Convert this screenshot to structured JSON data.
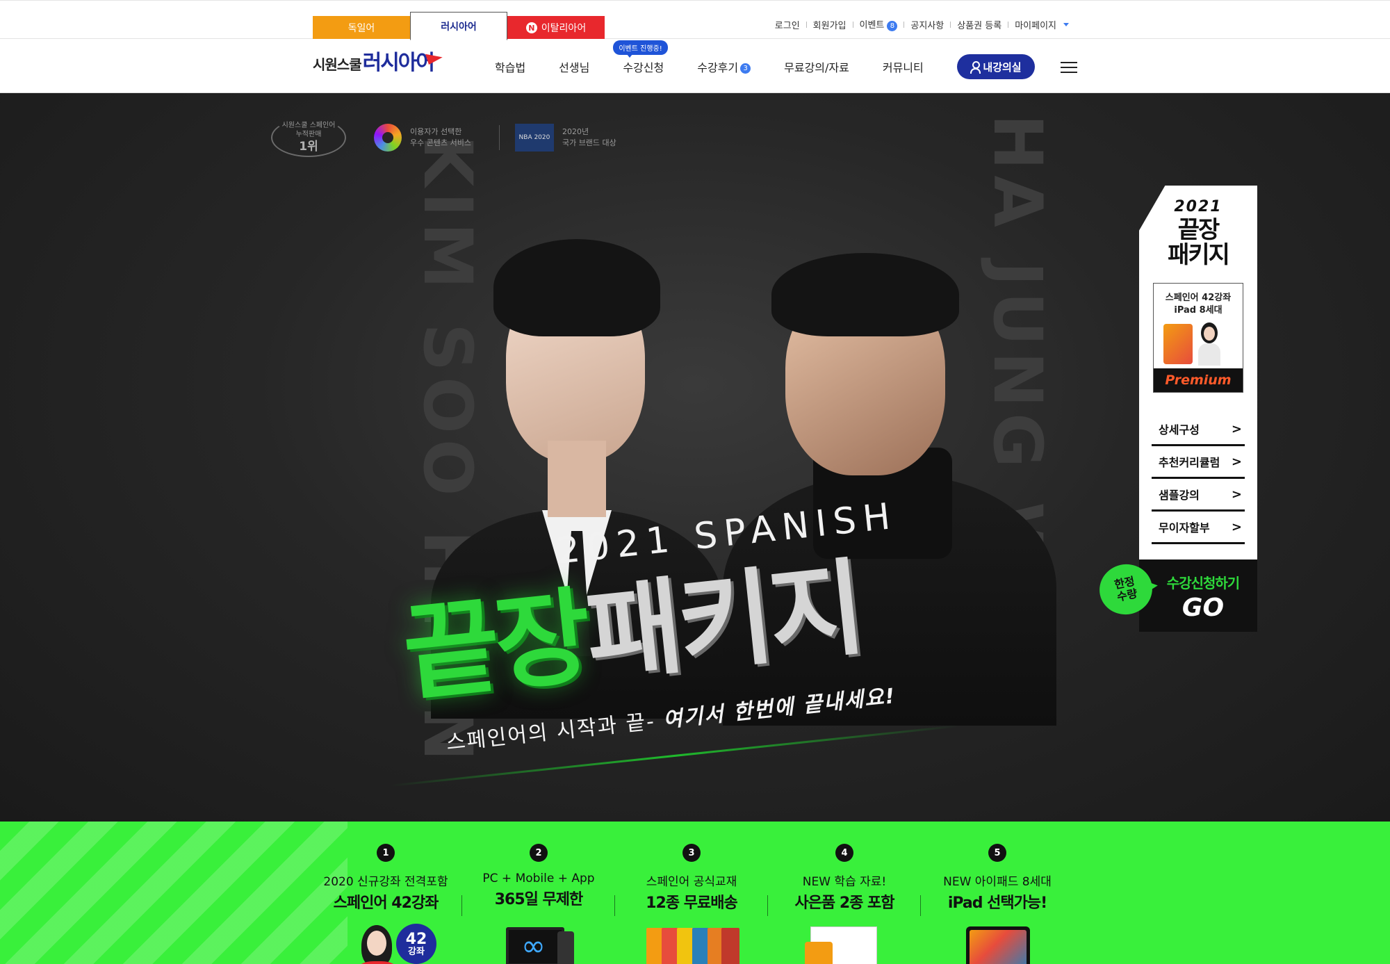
{
  "lang_tabs": [
    {
      "label": "독일어"
    },
    {
      "label": "러시아어"
    },
    {
      "label": "이탈리아어",
      "badge": "N"
    }
  ],
  "util_links": {
    "login": "로그인",
    "signup": "회원가입",
    "event": "이벤트",
    "event_count": "8",
    "notice": "공지사항",
    "voucher": "상품권 등록",
    "mypage": "마이페이지"
  },
  "logo": {
    "prefix": "시원스쿨",
    "name": "러시아어"
  },
  "nav": {
    "items": [
      "학습법",
      "선생님",
      "수강신청",
      "수강후기",
      "무료강의/자료",
      "커뮤니티"
    ],
    "event_bubble": "이벤트 진행중!",
    "review_count": "3",
    "my_classroom": "내강의실"
  },
  "hero": {
    "bg_name_left": "KIM SOO HYUN",
    "bg_name_right": "HA JUNG WOO",
    "awards": {
      "a1_line1": "시원스쿨 스페인어",
      "a1_line2": "누적판매",
      "a1_rank": "1위",
      "a2_line1": "이용자가 선택한",
      "a2_line2": "우수 콘텐츠 서비스",
      "a3_logo": "NBA 2020",
      "a3_line1": "2020년",
      "a3_line2": "국가 브랜드 대상"
    },
    "subtitle": "2021 SPANISH",
    "title_green": "끝장",
    "title_white": "패키지",
    "slogan_light": "스페인어의 시작과 끝-",
    "slogan_bold": "여기서 한번에 끝내세요!"
  },
  "side_banner": {
    "year": "2021",
    "title_l1": "끝장",
    "title_l2": "패키지",
    "card_l1": "스페인어 42강좌",
    "card_l2": "iPad 8세대",
    "card_foot": "Premium",
    "links": [
      "상세구성",
      "추천커리큘럼",
      "샘플강의",
      "무이자할부"
    ],
    "limit_l1": "한정",
    "limit_l2": "수량",
    "cta": "수강신청하기",
    "go": "GO"
  },
  "benefits": [
    {
      "num": "1",
      "sub": "2020 신규강좌 전격포함",
      "title": "스페인어 42강좌",
      "badge_num": "42",
      "badge_unit": "강좌"
    },
    {
      "num": "2",
      "sub": "PC + Mobile + App",
      "title": "365일 무제한"
    },
    {
      "num": "3",
      "sub": "스페인어 공식교재",
      "title": "12종 무료배송"
    },
    {
      "num": "4",
      "sub": "NEW 학습 자료!",
      "title": "사은품 2종 포함"
    },
    {
      "num": "5",
      "sub": "NEW 아이패드 8세대",
      "title": "iPad 선택가능!"
    }
  ],
  "colors": {
    "brand_navy": "#1e2f9e",
    "accent_green": "#39f03b",
    "tab_orange": "#f39c12",
    "tab_red": "#e8282d"
  }
}
